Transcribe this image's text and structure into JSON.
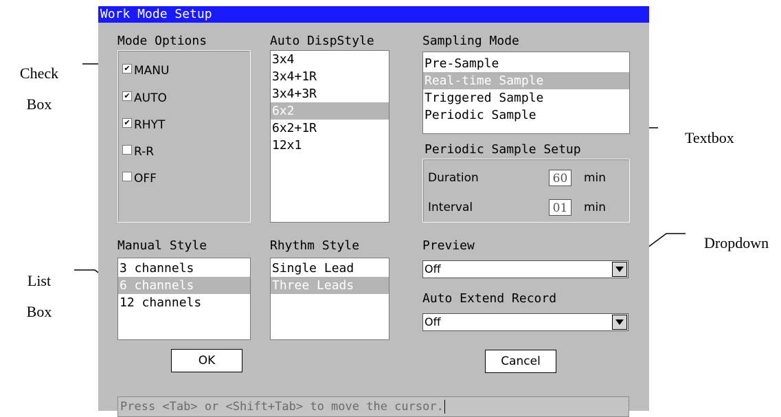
{
  "annotations": {
    "check_box": [
      "Check",
      "Box"
    ],
    "list_box": [
      "List",
      "Box"
    ],
    "textbox": "Textbox",
    "dropdown": "Dropdown"
  },
  "dialog": {
    "title": "Work Mode Setup",
    "mode_options": {
      "label": "Mode Options",
      "items": [
        {
          "label": "MANU",
          "checked": true
        },
        {
          "label": "AUTO",
          "checked": true
        },
        {
          "label": "RHYT",
          "checked": true
        },
        {
          "label": "R-R",
          "checked": false
        },
        {
          "label": "OFF",
          "checked": false
        }
      ]
    },
    "auto_disp_style": {
      "label": "Auto DispStyle",
      "items": [
        "3x4",
        "3x4+1R",
        "3x4+3R",
        "6x2",
        "6x2+1R",
        "12x1"
      ],
      "selected": "6x2"
    },
    "sampling_mode": {
      "label": "Sampling Mode",
      "items": [
        "Pre-Sample",
        "Real-time Sample",
        "Triggered Sample",
        "Periodic Sample"
      ],
      "selected": "Real-time Sample"
    },
    "periodic_setup": {
      "label": "Periodic Sample Setup",
      "duration_label": "Duration",
      "duration_value": "60",
      "interval_label": "Interval",
      "interval_value": "01",
      "unit": "min"
    },
    "manual_style": {
      "label": "Manual Style",
      "items": [
        "3 channels",
        "6 channels",
        "12 channels"
      ],
      "selected": "6 channels"
    },
    "rhythm_style": {
      "label": "Rhythm Style",
      "items": [
        "Single Lead",
        "Three Leads"
      ],
      "selected": "Three Leads"
    },
    "preview": {
      "label": "Preview",
      "value": "Off"
    },
    "auto_extend": {
      "label": "Auto Extend Record",
      "value": "Off"
    },
    "ok_label": "OK",
    "cancel_label": "Cancel",
    "status_text": "Press <Tab> or <Shift+Tab> to move the cursor.",
    "colors": {
      "title_bar": "#1a1aff",
      "panel": "#bdbdbd",
      "selection": "#b5b5b5"
    }
  }
}
